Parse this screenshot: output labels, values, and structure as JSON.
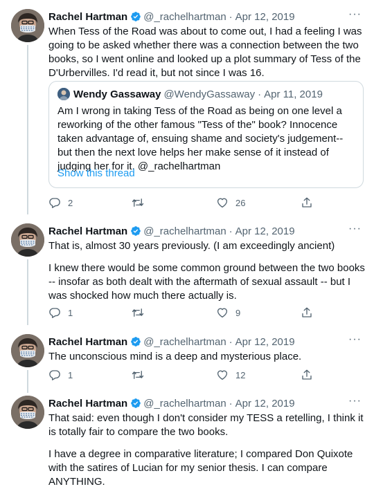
{
  "tweets": [
    {
      "author": "Rachel Hartman",
      "handle": "@_rachelhartman",
      "date": "Apr 12, 2019",
      "text": "When Tess of the Road was about to come out, I had a feeling I was going to be asked whether there was a connection between the two books, so I went online and looked up a plot summary of Tess of the D'Urbervilles. I'd read it, but not since I was 16.",
      "quote": {
        "author": "Wendy Gassaway",
        "handle": "@WendyGassaway",
        "date": "Apr 11, 2019",
        "text": "Am I wrong in taking Tess of the Road as being on one level a reworking of the other famous \"Tess of the\" book? Innocence taken advantage of, ensuing shame and society's judgement--but then the next love helps her make sense of it instead of judging her for it. @_rachelhartman",
        "link": "Show this thread"
      },
      "replies": "2",
      "retweets": "",
      "likes": "26"
    },
    {
      "author": "Rachel Hartman",
      "handle": "@_rachelhartman",
      "date": "Apr 12, 2019",
      "text_p1": "That is, almost 30 years previously. (I am exceedingly ancient)",
      "text_p2": "I knew there would be some common ground between the two books -- insofar as both dealt with the aftermath of sexual assault -- but I was shocked how much there actually is.",
      "replies": "1",
      "retweets": "",
      "likes": "9"
    },
    {
      "author": "Rachel Hartman",
      "handle": "@_rachelhartman",
      "date": "Apr 12, 2019",
      "text": "The unconscious mind is a deep and mysterious place.",
      "replies": "1",
      "retweets": "",
      "likes": "12"
    },
    {
      "author": "Rachel Hartman",
      "handle": "@_rachelhartman",
      "date": "Apr 12, 2019",
      "text_p1": "That said: even though I don't consider my TESS a retelling, I think it is totally fair to compare the two books.",
      "text_p2": "I have a degree in comparative literature; I compared Don Quixote with the satires of Lucian for my senior thesis. I can compare ANYTHING."
    }
  ],
  "separator": "·",
  "more_label": "···",
  "icons": [
    "verified-icon",
    "reply-icon",
    "retweet-icon",
    "like-icon",
    "share-icon",
    "more-icon"
  ],
  "colors": {
    "accent": "#1d9bf0",
    "secondary_text": "#536471",
    "border": "#cfd9de"
  }
}
